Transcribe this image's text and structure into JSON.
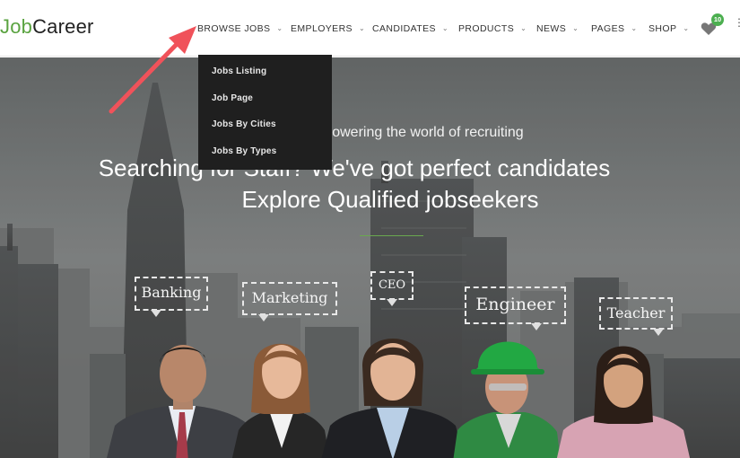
{
  "header": {
    "logo_part1": "Job",
    "logo_part2": "Career",
    "nav": [
      {
        "label": "BROWSE JOBS"
      },
      {
        "label": "EMPLOYERS"
      },
      {
        "label": "CANDIDATES"
      },
      {
        "label": "PRODUCTS"
      },
      {
        "label": "NEWS"
      },
      {
        "label": "PAGES"
      },
      {
        "label": "SHOP"
      }
    ],
    "wishlist_count": "10"
  },
  "dropdown": {
    "items": [
      {
        "label": "Jobs Listing"
      },
      {
        "label": "Job Page"
      },
      {
        "label": "Jobs By Cities"
      },
      {
        "label": "Jobs By Types"
      }
    ]
  },
  "hero": {
    "tagline": "powering the world of recruiting",
    "title": "Searching for Staff? We've got perfect candidates",
    "subtitle": "Explore Qualified jobseekers",
    "bubbles": [
      "Banking",
      "Marketing",
      "CEO",
      "Engineer",
      "Teacher"
    ]
  },
  "colors": {
    "accent": "#5aa340",
    "badge": "#4caf50",
    "dropdown_bg": "#1f1f1f",
    "arrow": "#f0525a"
  }
}
